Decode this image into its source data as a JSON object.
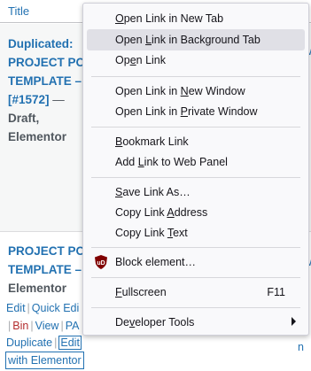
{
  "table": {
    "column_title": "Title"
  },
  "post1": {
    "title_lines": [
      "Duplicated:",
      "PROJECT POS",
      "TEMPLATE –",
      "[#1572]"
    ],
    "dash": " —",
    "state_lines": [
      "Draft,",
      "Elementor"
    ]
  },
  "post2": {
    "title_lines": [
      "PROJECT POS",
      "TEMPLATE –"
    ],
    "state": "Elementor",
    "actions": {
      "edit": "Edit",
      "quick_edit": "Quick Edi",
      "bin": "Bin",
      "view": "View",
      "preview": "PA",
      "duplicate": "Duplicate",
      "edit_with_elementor_1": "Edit",
      "edit_with_elementor_2": "with Elementor",
      "sep": "|"
    }
  },
  "right_fragments": {
    "r1": "t",
    "r2": "ew",
    "r3": "n",
    "r4": "E",
    "r5": "n",
    "r6": "t",
    "r7": "ew",
    "r8": "n",
    "r9": "E",
    "r10": "n"
  },
  "context_menu": {
    "items": [
      {
        "pre": "",
        "u": "O",
        "post": "pen Link in New Tab"
      },
      {
        "pre": "Open ",
        "u": "L",
        "post": "ink in Background Tab"
      },
      {
        "pre": "Op",
        "u": "e",
        "post": "n Link"
      },
      {
        "pre": "Open Link in ",
        "u": "N",
        "post": "ew Window"
      },
      {
        "pre": "Open Link in ",
        "u": "P",
        "post": "rivate Window"
      },
      {
        "pre": "",
        "u": "B",
        "post": "ookmark Link"
      },
      {
        "pre": "Add ",
        "u": "L",
        "post": "ink to Web Panel"
      },
      {
        "pre": "",
        "u": "S",
        "post": "ave Link As…"
      },
      {
        "pre": "Copy Link ",
        "u": "A",
        "post": "ddress"
      },
      {
        "pre": "Copy Link ",
        "u": "T",
        "post": "ext"
      },
      {
        "pre": "Block element…",
        "u": "",
        "post": ""
      },
      {
        "pre": "",
        "u": "F",
        "post": "ullscreen"
      },
      {
        "pre": "De",
        "u": "v",
        "post": "eloper Tools"
      }
    ],
    "fullscreen_shortcut": "F11",
    "hovered_item": "Open Link in Background Tab",
    "ublock_badge": "uD",
    "colors": {
      "background": "#f9f9fb",
      "hover": "#e0e0e6",
      "ublock_red": "#800000"
    }
  }
}
